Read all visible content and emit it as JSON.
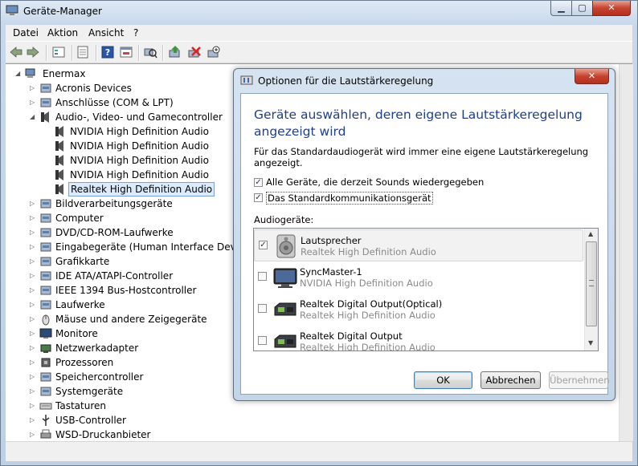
{
  "window": {
    "title": "Geräte-Manager"
  },
  "menu": [
    "Datei",
    "Aktion",
    "Ansicht",
    "?"
  ],
  "tree": {
    "root": "Enermax",
    "items": [
      {
        "label": "Acronis Devices",
        "icon": "device-icon",
        "level": 1,
        "expander": "collapsed"
      },
      {
        "label": "Anschlüsse (COM & LPT)",
        "icon": "port-icon",
        "level": 1,
        "expander": "collapsed"
      },
      {
        "label": "Audio-, Video- und Gamecontroller",
        "icon": "speaker-icon",
        "level": 1,
        "expander": "expanded"
      },
      {
        "label": "NVIDIA High Definition Audio",
        "icon": "speaker-icon",
        "level": 2,
        "expander": "none"
      },
      {
        "label": "NVIDIA High Definition Audio",
        "icon": "speaker-icon",
        "level": 2,
        "expander": "none"
      },
      {
        "label": "NVIDIA High Definition Audio",
        "icon": "speaker-icon",
        "level": 2,
        "expander": "none"
      },
      {
        "label": "NVIDIA High Definition Audio",
        "icon": "speaker-icon",
        "level": 2,
        "expander": "none"
      },
      {
        "label": "Realtek High Definition Audio",
        "icon": "speaker-icon",
        "level": 2,
        "expander": "none",
        "selected": true
      },
      {
        "label": "Bildverarbeitungsgeräte",
        "icon": "camera-icon",
        "level": 1,
        "expander": "collapsed"
      },
      {
        "label": "Computer",
        "icon": "computer-icon",
        "level": 1,
        "expander": "collapsed"
      },
      {
        "label": "DVD/CD-ROM-Laufwerke",
        "icon": "disc-drive-icon",
        "level": 1,
        "expander": "collapsed"
      },
      {
        "label": "Eingabegeräte (Human Interface Devices)",
        "icon": "hid-icon",
        "level": 1,
        "expander": "collapsed"
      },
      {
        "label": "Grafikkarte",
        "icon": "display-adapter-icon",
        "level": 1,
        "expander": "collapsed"
      },
      {
        "label": "IDE ATA/ATAPI-Controller",
        "icon": "ide-controller-icon",
        "level": 1,
        "expander": "collapsed"
      },
      {
        "label": "IEEE 1394 Bus-Hostcontroller",
        "icon": "firewire-icon",
        "level": 1,
        "expander": "collapsed"
      },
      {
        "label": "Laufwerke",
        "icon": "disk-icon",
        "level": 1,
        "expander": "collapsed"
      },
      {
        "label": "Mäuse und andere Zeigegeräte",
        "icon": "mouse-icon",
        "level": 1,
        "expander": "collapsed"
      },
      {
        "label": "Monitore",
        "icon": "monitor-icon",
        "level": 1,
        "expander": "collapsed"
      },
      {
        "label": "Netzwerkadapter",
        "icon": "network-icon",
        "level": 1,
        "expander": "collapsed"
      },
      {
        "label": "Prozessoren",
        "icon": "processor-icon",
        "level": 1,
        "expander": "collapsed"
      },
      {
        "label": "Speichercontroller",
        "icon": "storage-controller-icon",
        "level": 1,
        "expander": "collapsed"
      },
      {
        "label": "Systemgeräte",
        "icon": "system-device-icon",
        "level": 1,
        "expander": "collapsed"
      },
      {
        "label": "Tastaturen",
        "icon": "keyboard-icon",
        "level": 1,
        "expander": "collapsed"
      },
      {
        "label": "USB-Controller",
        "icon": "usb-icon",
        "level": 1,
        "expander": "collapsed"
      },
      {
        "label": "WSD-Druckanbieter",
        "icon": "printer-icon",
        "level": 1,
        "expander": "collapsed"
      }
    ]
  },
  "dialog": {
    "title": "Optionen für die Lautstärkeregelung",
    "heading": "Geräte auswählen, deren eigene Lautstärkeregelung angezeigt wird",
    "description": "Für das Standardaudiogerät wird immer eine eigene Lautstärkeregelung angezeigt.",
    "checkboxes": [
      {
        "label": "Alle Geräte, die derzeit Sounds wiedergegeben",
        "checked": true
      },
      {
        "label": "Das Standardkommunikationsgerät",
        "checked": true
      }
    ],
    "list_label": "Audiogeräte:",
    "devices": [
      {
        "name": "Lautsprecher",
        "sub": "Realtek High Definition Audio",
        "checked": true,
        "icon": "speaker-device-icon"
      },
      {
        "name": "SyncMaster-1",
        "sub": "NVIDIA High Definition Audio",
        "checked": false,
        "icon": "monitor-device-icon"
      },
      {
        "name": "Realtek Digital Output(Optical)",
        "sub": "Realtek High Definition Audio",
        "checked": false,
        "icon": "digital-output-icon"
      },
      {
        "name": "Realtek Digital Output",
        "sub": "Realtek High Definition Audio",
        "checked": false,
        "icon": "digital-output-icon"
      }
    ],
    "buttons": {
      "ok": "OK",
      "cancel": "Abbrechen",
      "apply": "Übernehmen"
    }
  }
}
